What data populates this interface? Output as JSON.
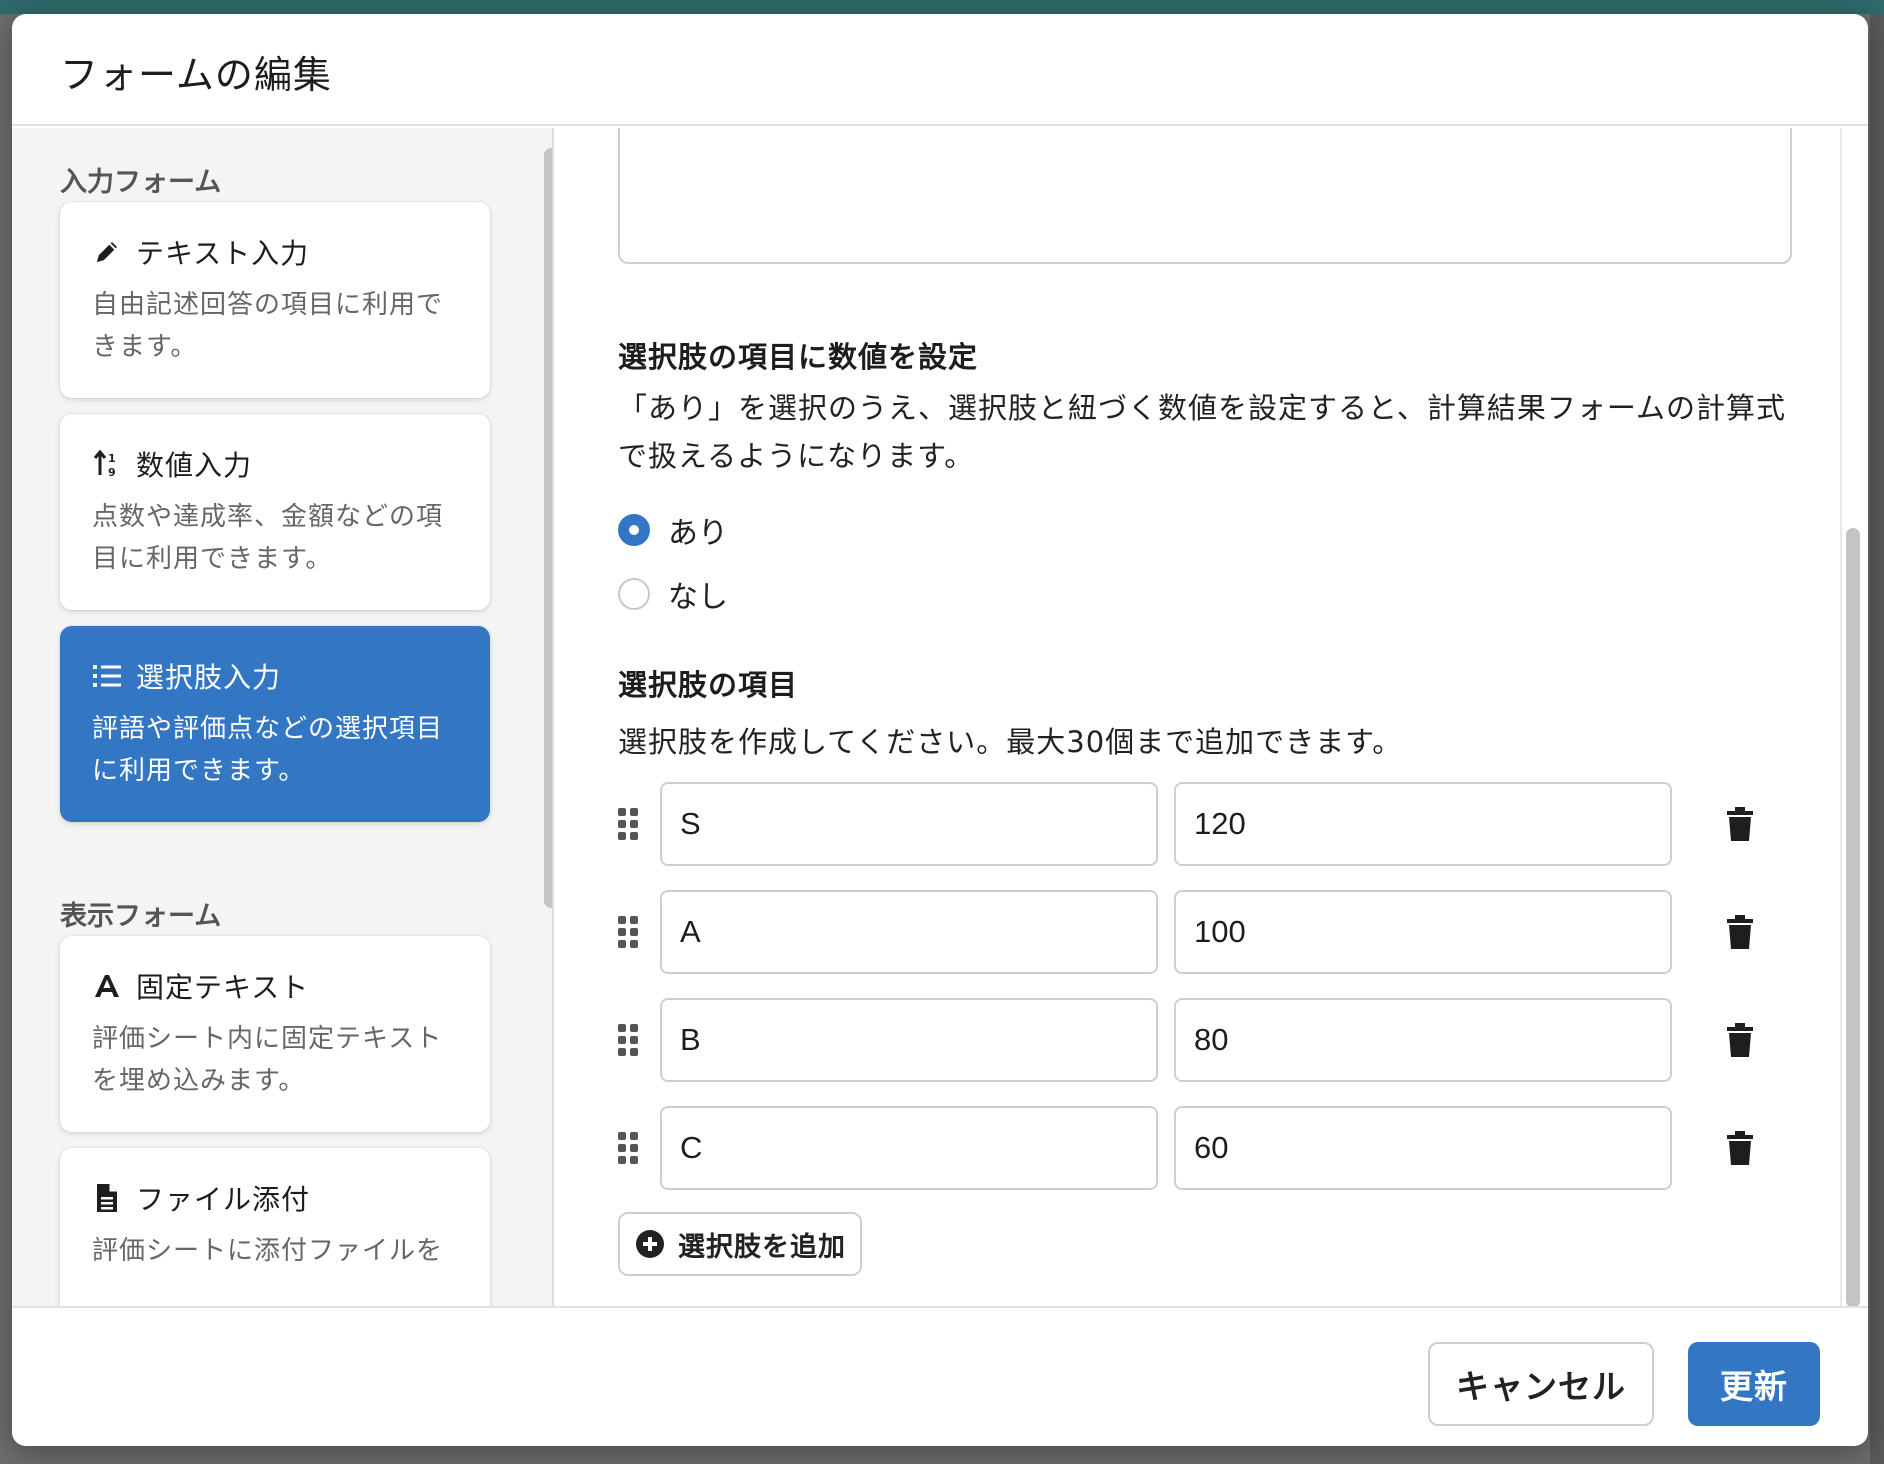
{
  "modal": {
    "title": "フォームの編集"
  },
  "palette": {
    "input_section_title": "入力フォーム",
    "display_section_title": "表示フォーム",
    "input_items": [
      {
        "icon": "pencil-icon",
        "label": "テキスト入力",
        "description": "自由記述回答の項目に利用できます。",
        "active": false
      },
      {
        "icon": "sort-numeric-icon",
        "label": "数値入力",
        "description": "点数や達成率、金額などの項目に利用できます。",
        "active": false
      },
      {
        "icon": "list-icon",
        "label": "選択肢入力",
        "description": "評語や評価点などの選択項目に利用できます。",
        "active": true
      }
    ],
    "display_items": [
      {
        "icon": "font-icon",
        "label": "固定テキスト",
        "description": "評価シート内に固定テキストを埋め込みます。"
      },
      {
        "icon": "file-icon",
        "label": "ファイル添付",
        "description": "評価シートに添付ファイルを"
      }
    ]
  },
  "settings": {
    "numeric_heading": "選択肢の項目に数値を設定",
    "numeric_description": "「あり」を選択のうえ、選択肢と紐づく数値を設定すると、計算結果フォームの計算式で扱えるようになります。",
    "radio_options": [
      {
        "label": "あり",
        "checked": true
      },
      {
        "label": "なし",
        "checked": false
      }
    ],
    "options_heading": "選択肢の項目",
    "options_description": "選択肢を作成してください。最大30個まで追加できます。",
    "options": [
      {
        "label": "S",
        "value": "120"
      },
      {
        "label": "A",
        "value": "100"
      },
      {
        "label": "B",
        "value": "80"
      },
      {
        "label": "C",
        "value": "60"
      }
    ],
    "add_option_label": "選択肢を追加"
  },
  "footer": {
    "cancel_label": "キャンセル",
    "update_label": "更新"
  },
  "colors": {
    "accent": "#3376c4",
    "backdrop_topbar": "#2f6a6a"
  }
}
